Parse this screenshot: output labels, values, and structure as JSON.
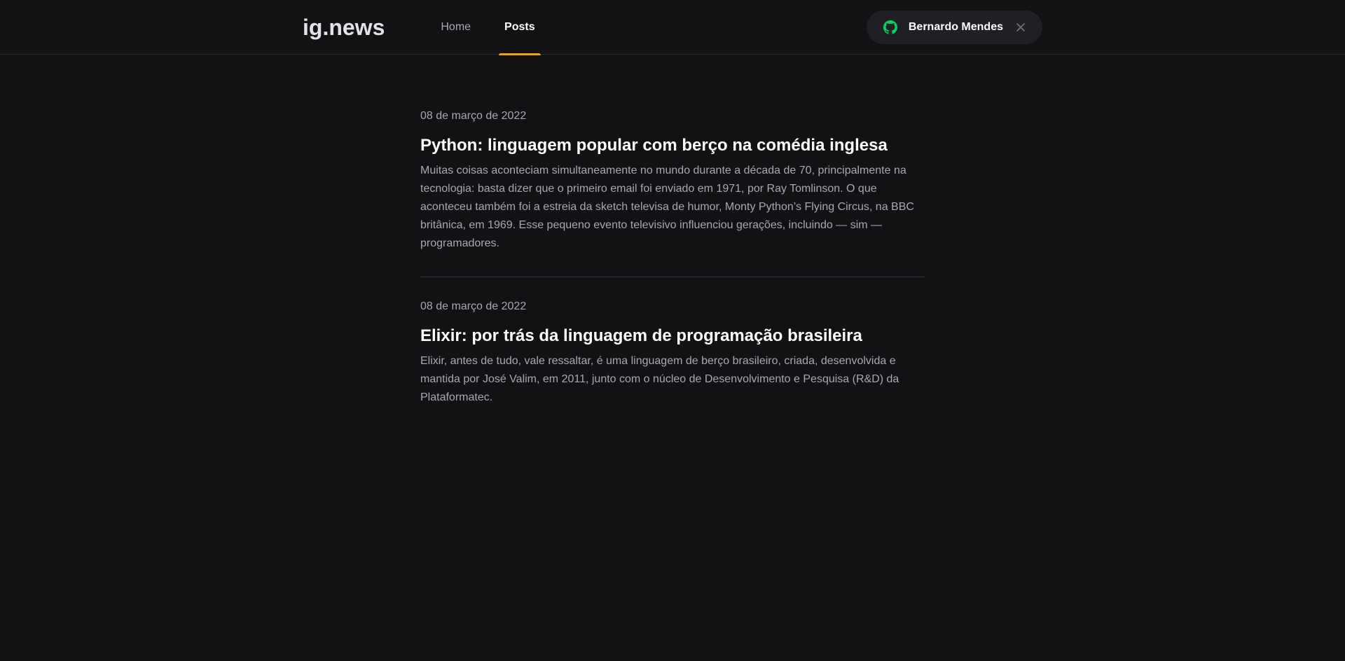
{
  "header": {
    "logo": "ig.news",
    "nav": [
      {
        "label": "Home",
        "active": false
      },
      {
        "label": "Posts",
        "active": true
      }
    ],
    "user": {
      "name": "Bernardo Mendes",
      "icon": "github-icon",
      "close_icon": "close-icon"
    }
  },
  "colors": {
    "accent": "#eba417",
    "github_green": "#04d361",
    "background": "#121214"
  },
  "posts": [
    {
      "date": "08 de março de 2022",
      "title": "Python: linguagem popular com berço na comédia inglesa",
      "excerpt": "Muitas coisas aconteciam simultaneamente no mundo durante a década de 70, principalmente na tecnologia: basta dizer que o primeiro email foi enviado em 1971, por Ray Tomlinson. O que aconteceu também foi a estreia da sketch televisa de humor, Monty Python’s Flying Circus, na BBC britânica, em 1969. Esse pequeno evento televisivo influenciou gerações, incluindo — sim — programadores."
    },
    {
      "date": "08 de março de 2022",
      "title": "Elixir: por trás da linguagem de programação brasileira",
      "excerpt": "Elixir, antes de tudo, vale ressaltar, é uma linguagem de berço brasileiro, criada, desenvolvida e mantida por José Valim, em 2011, junto com o núcleo de Desenvolvimento e Pesquisa (R&D) da Plataformatec."
    }
  ]
}
